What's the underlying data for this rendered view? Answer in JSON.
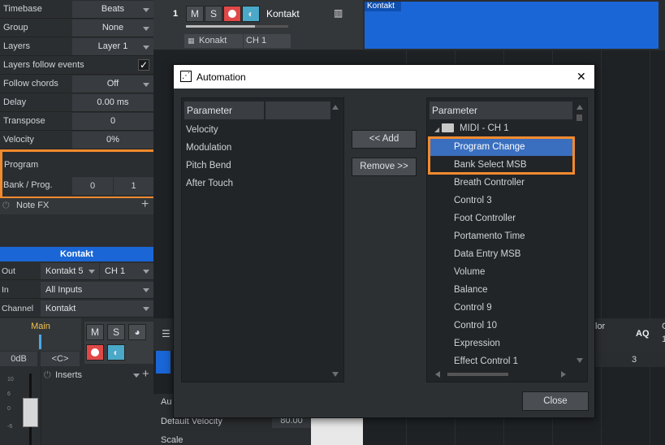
{
  "inspector": {
    "rows": [
      {
        "label": "Timebase",
        "value": "Beats"
      },
      {
        "label": "Group",
        "value": "None"
      },
      {
        "label": "Layers",
        "value": "Layer 1"
      },
      {
        "label": "Layers follow events",
        "value": ""
      },
      {
        "label": "Follow chords",
        "value": "Off"
      },
      {
        "label": "Delay",
        "value": "0.00 ms"
      },
      {
        "label": "Transpose",
        "value": "0"
      },
      {
        "label": "Velocity",
        "value": "0%"
      }
    ],
    "program_label": "Program",
    "bank_prog_label": "Bank / Prog.",
    "bank_value": "0",
    "prog_value": "1",
    "note_fx_label": "Note FX",
    "checkmark": "✓"
  },
  "track": {
    "number": "1",
    "mute": "M",
    "solo": "S",
    "name": "Kontakt",
    "instrument": "Konakt",
    "channel": "CH 1",
    "event_name": "Kontakt"
  },
  "channel_strip": {
    "title": "Kontakt",
    "out_label": "Out",
    "out_value": "Kontakt 5",
    "out_channel": "CH 1",
    "in_label": "In",
    "in_value": "All Inputs",
    "channel_label": "Channel",
    "channel_value": "Kontakt",
    "main_label": "Main",
    "mute": "M",
    "solo": "S",
    "volume": "0dB",
    "pan": "<C>",
    "inserts_label": "Inserts",
    "meter_ticks": [
      "10",
      "6",
      "0",
      "-6"
    ]
  },
  "background_right": {
    "color_label": "lor",
    "aq_label": "AQ",
    "bar_number": "3",
    "default_velocity_label": "Default Velocity",
    "default_velocity_value": "80.00",
    "scale_label": "Scale",
    "au_label": "Au",
    "c_label": "C",
    "one_label": "1"
  },
  "dialog": {
    "title": "Automation",
    "close_x": "✕",
    "left_panel": {
      "header": "Parameter",
      "items": [
        "Velocity",
        "Modulation",
        "Pitch Bend",
        "After Touch"
      ]
    },
    "add_button": "<< Add",
    "remove_button": "Remove >>",
    "right_panel": {
      "header": "Parameter",
      "folder": "MIDI - CH 1",
      "items": [
        "Program Change",
        "Bank Select MSB",
        "Breath Controller",
        "Control 3",
        "Foot Controller",
        "Portamento Time",
        "Data Entry MSB",
        "Volume",
        "Balance",
        "Control 9",
        "Control 10",
        "Expression",
        "Effect Control 1"
      ],
      "selected_item": "Program Change"
    },
    "close_button": "Close"
  },
  "colors": {
    "highlight_orange": "#f28a2e",
    "selection_blue": "#3a6fbf",
    "event_blue": "#1a66d6",
    "record_red": "#e04848",
    "monitor_blue": "#4aa8c8"
  }
}
